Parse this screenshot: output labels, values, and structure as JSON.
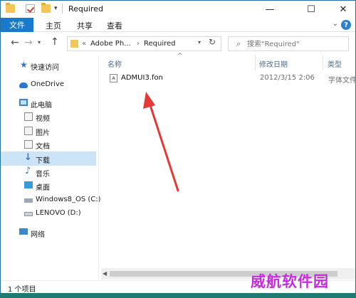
{
  "window": {
    "title": "Required",
    "minimize_glyph": "—",
    "maximize_glyph": "☐",
    "close_glyph": "✕",
    "quick_access_caret": "▾"
  },
  "ribbon": {
    "file_tab": "文件",
    "tabs": [
      "主页",
      "共享",
      "查看"
    ],
    "expand_glyph": "⌄",
    "help_glyph": "?"
  },
  "navbar": {
    "back_glyph": "←",
    "forward_glyph": "→",
    "recent_glyph": "▾",
    "up_glyph": "↑",
    "address": {
      "overflow": "«",
      "segments": [
        "Adobe Ph...",
        "Required"
      ],
      "separator": "›",
      "dropdown_glyph": "▾",
      "refresh_glyph": "↻"
    },
    "search": {
      "placeholder": "搜索\"Required\"",
      "icon_glyph": "⌕"
    }
  },
  "sidebar": {
    "items": [
      {
        "label": "快速访问"
      },
      {
        "label": "OneDrive"
      },
      {
        "label": "此电脑"
      },
      {
        "label": "视频"
      },
      {
        "label": "图片"
      },
      {
        "label": "文档"
      },
      {
        "label": "下载"
      },
      {
        "label": "音乐"
      },
      {
        "label": "桌面"
      },
      {
        "label": "Windows8_OS (C:)"
      },
      {
        "label": "LENOVO (D:)"
      },
      {
        "label": "网络"
      }
    ],
    "selected_index": 6
  },
  "content": {
    "sort_glyph": "^",
    "columns": [
      "名称",
      "修改日期",
      "类型"
    ],
    "files": [
      {
        "name": "ADMUI3.fon",
        "modified": "2012/3/15 2:06",
        "type": "字体文件",
        "icon_text": "A"
      }
    ],
    "scroll_left_glyph": "◀"
  },
  "statusbar": {
    "text": "1 个项目"
  },
  "watermark": {
    "text": "威航软件园"
  },
  "annotation": {
    "color": "#e53935"
  }
}
